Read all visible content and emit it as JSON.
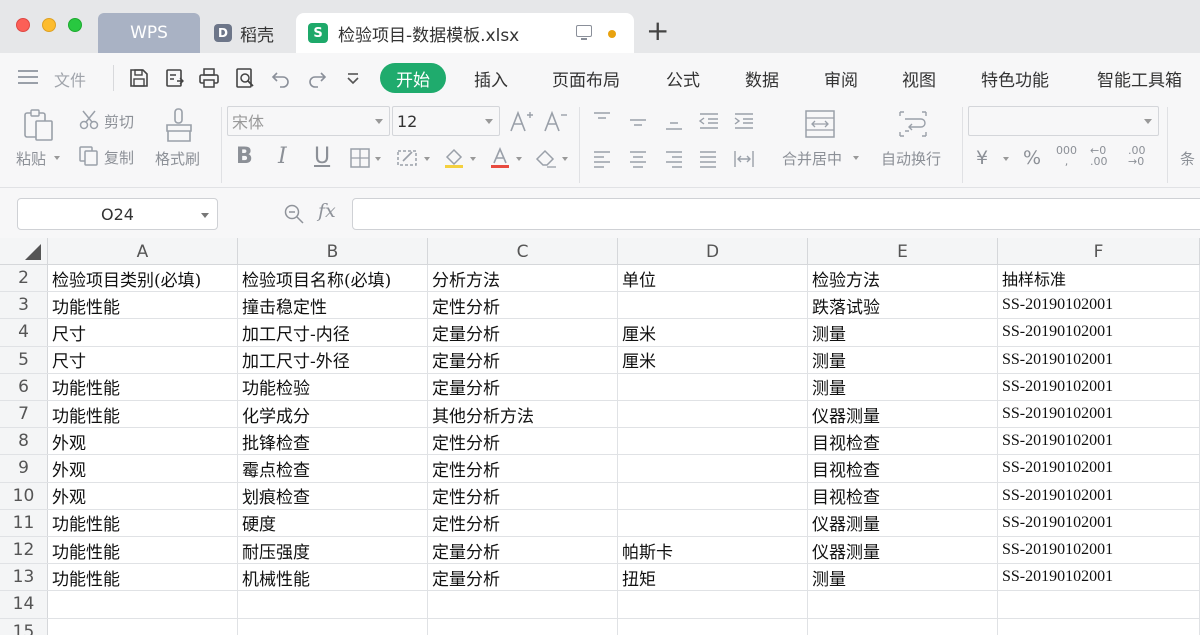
{
  "tabs": {
    "wps": "WPS",
    "daoke": "稻壳",
    "daoke_icon": "D",
    "file": "检验项目-数据模板.xlsx",
    "file_icon": "S",
    "new_tab": "+"
  },
  "menu": {
    "file": "文件",
    "items": [
      "开始",
      "插入",
      "页面布局",
      "公式",
      "数据",
      "审阅",
      "视图",
      "特色功能",
      "智能工具箱"
    ]
  },
  "ribbon": {
    "paste": "粘贴",
    "cut": "剪切",
    "copy": "复制",
    "format_painter": "格式刷",
    "font_name": "宋体",
    "font_size": "12",
    "merge_center": "合并居中",
    "wrap_text": "自动换行",
    "cond_partial": "条"
  },
  "formula_bar": {
    "cell_ref": "O24",
    "fx": "fx",
    "value": ""
  },
  "grid": {
    "columns": [
      "A",
      "B",
      "C",
      "D",
      "E",
      "F"
    ],
    "rows": [
      {
        "num": "2",
        "cells": [
          "检验项目类别(必填)",
          "检验项目名称(必填)",
          "分析方法",
          "单位",
          "检验方法",
          "抽样标准"
        ]
      },
      {
        "num": "3",
        "cells": [
          "功能性能",
          "撞击稳定性",
          "定性分析",
          "",
          "跌落试验",
          "SS-20190102001"
        ]
      },
      {
        "num": "4",
        "cells": [
          "尺寸",
          "加工尺寸-内径",
          "定量分析",
          "厘米",
          "测量",
          "SS-20190102001"
        ]
      },
      {
        "num": "5",
        "cells": [
          "尺寸",
          "加工尺寸-外径",
          "定量分析",
          "厘米",
          "测量",
          "SS-20190102001"
        ]
      },
      {
        "num": "6",
        "cells": [
          "功能性能",
          "功能检验",
          "定量分析",
          "",
          "测量",
          "SS-20190102001"
        ]
      },
      {
        "num": "7",
        "cells": [
          "功能性能",
          "化学成分",
          "其他分析方法",
          "",
          "仪器测量",
          "SS-20190102001"
        ]
      },
      {
        "num": "8",
        "cells": [
          "外观",
          "批锋检查",
          "定性分析",
          "",
          "目视检查",
          "SS-20190102001"
        ]
      },
      {
        "num": "9",
        "cells": [
          "外观",
          "霉点检查",
          "定性分析",
          "",
          "目视检查",
          "SS-20190102001"
        ]
      },
      {
        "num": "10",
        "cells": [
          "外观",
          "划痕检查",
          "定性分析",
          "",
          "目视检查",
          "SS-20190102001"
        ]
      },
      {
        "num": "11",
        "cells": [
          "功能性能",
          "硬度",
          "定性分析",
          "",
          "仪器测量",
          "SS-20190102001"
        ]
      },
      {
        "num": "12",
        "cells": [
          "功能性能",
          "耐压强度",
          "定量分析",
          "帕斯卡",
          "仪器测量",
          "SS-20190102001"
        ]
      },
      {
        "num": "13",
        "cells": [
          "功能性能",
          "机械性能",
          "定量分析",
          "扭矩",
          "测量",
          "SS-20190102001"
        ]
      },
      {
        "num": "14",
        "cells": [
          "",
          "",
          "",
          "",
          "",
          ""
        ]
      },
      {
        "num": "15",
        "cells": [
          "",
          "",
          "",
          "",
          "",
          ""
        ]
      }
    ]
  },
  "colors": {
    "accent_green": "#1fab6d",
    "wps_tab": "#a9b2c4",
    "unsaved_dot": "#e8a20f"
  }
}
